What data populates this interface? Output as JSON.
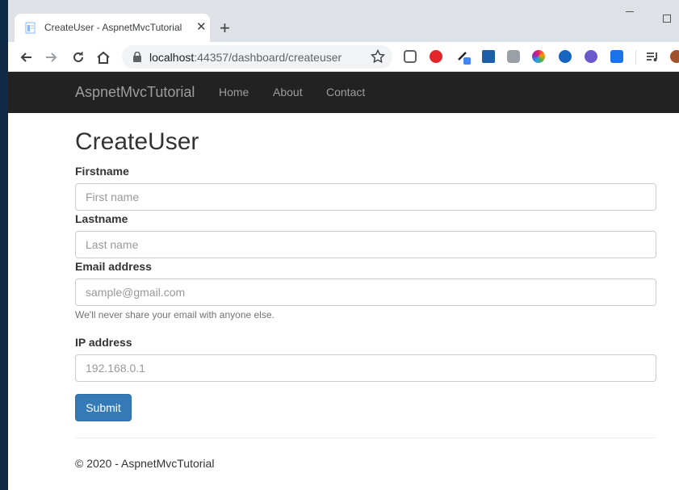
{
  "browser": {
    "tab_title": "CreateUser - AspnetMvcTutorial",
    "tab_close": "✕",
    "new_tab": "+",
    "url_host": "localhost",
    "url_path": ":44357/dashboard/createuser"
  },
  "icons": {
    "back": "back-arrow-icon",
    "forward": "forward-arrow-icon",
    "reload": "reload-icon",
    "home": "home-icon",
    "lock": "lock-icon",
    "bookmark": "star-icon"
  },
  "extensions": [
    {
      "name": "pocket-icon",
      "color": "#5f6368"
    },
    {
      "name": "adblock-icon",
      "color": "#e3262a"
    },
    {
      "name": "eyedropper-icon",
      "color": "#1a73e8"
    },
    {
      "name": "screenshot-icon",
      "color": "#1c5fa8"
    },
    {
      "name": "mendeley-icon",
      "color": "#9aa0a6"
    },
    {
      "name": "colorpick-icon",
      "color": "#c2185b"
    },
    {
      "name": "d-extension-icon",
      "color": "#1565c0"
    },
    {
      "name": "check-extension-icon",
      "color": "#6a5acd"
    },
    {
      "name": "bracket-extension-icon",
      "color": "#1a73e8"
    }
  ],
  "navbar": {
    "brand": "AspnetMvcTutorial",
    "links": [
      "Home",
      "About",
      "Contact"
    ]
  },
  "form": {
    "title": "CreateUser",
    "firstname_label": "Firstname",
    "firstname_placeholder": "First name",
    "lastname_label": "Lastname",
    "lastname_placeholder": "Last name",
    "email_label": "Email address",
    "email_placeholder": "sample@gmail.com",
    "email_help": "We'll never share your email with anyone else.",
    "ip_label": "IP address",
    "ip_placeholder": "192.168.0.1",
    "submit_label": "Submit"
  },
  "footer": {
    "text": "© 2020 - AspnetMvcTutorial"
  },
  "colors": {
    "navbar_bg": "#222222",
    "primary_button": "#337ab7"
  }
}
